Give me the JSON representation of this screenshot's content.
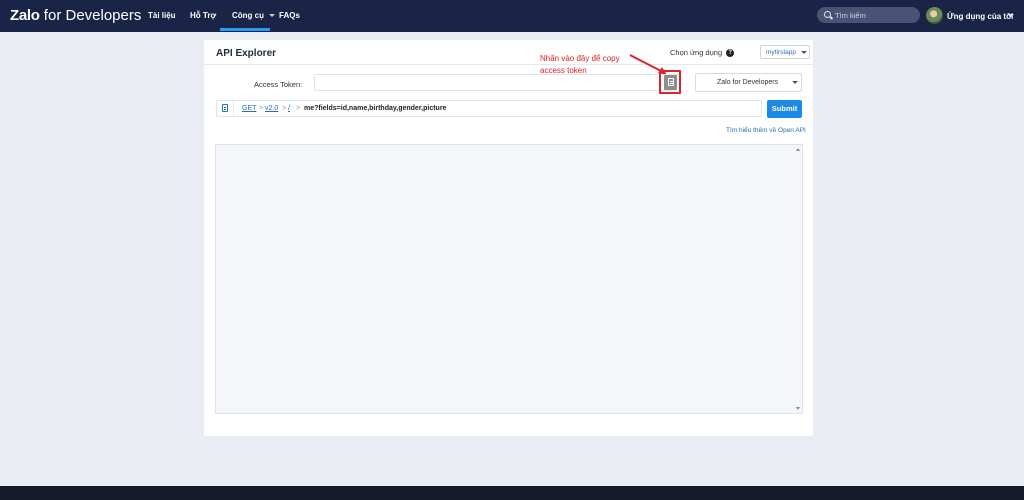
{
  "nav": {
    "brand_bold": "Zalo",
    "brand_rest": " for Developers",
    "items": [
      "Tài liệu",
      "Hỗ Trợ",
      "Công cụ",
      "FAQs"
    ],
    "search_placeholder": "Tìm kiếm",
    "user_menu": "Ứng dụng của tôi",
    "colors": {
      "bar": "#1a2447",
      "active": "#2b9af3"
    }
  },
  "explorer": {
    "title": "API Explorer",
    "app_label": "Chọn ứng dụng",
    "app_selected": "myfirstapp",
    "annotation": "Nhấn vào đây để copy access token",
    "token_label": "Access Token:",
    "token_value": "",
    "sdk_selected": "Zalo for Developers",
    "path": {
      "method": "GET",
      "version": "v2.0",
      "root": "/",
      "query": "me?fields=id,name,birthday,gender,picture"
    },
    "submit_label": "Submit",
    "openapi_link": "Tìm hiểu thêm về Open API",
    "response_text": ""
  }
}
